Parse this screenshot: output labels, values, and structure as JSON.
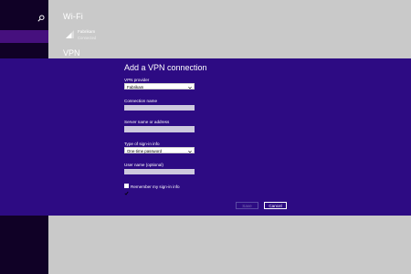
{
  "nav": {},
  "content": {
    "wifi_header": "Wi-Fi",
    "network": {
      "name": "Fabrikam",
      "status": "Connected"
    },
    "vpn_header": "VPN"
  },
  "dialog": {
    "title": "Add a VPN connection",
    "vpn_provider_label": "VPN provider",
    "vpn_provider_value": "Fabrikam",
    "connection_name_label": "Connection name",
    "connection_name_value": "",
    "server_label": "Server name or address",
    "server_value": "",
    "signin_type_label": "Type of sign-in info",
    "signin_type_value": "One-time password",
    "username_label": "User name (optional)",
    "username_value": "",
    "remember_label": "Remember my sign-in info",
    "remember_checked": true,
    "save_label": "Save",
    "cancel_label": "Cancel"
  },
  "colors": {
    "dialog_bg": "#2d0b83",
    "nav_bg": "#100126",
    "nav_selected": "#46107e",
    "content_bg": "#c9c9c9"
  }
}
